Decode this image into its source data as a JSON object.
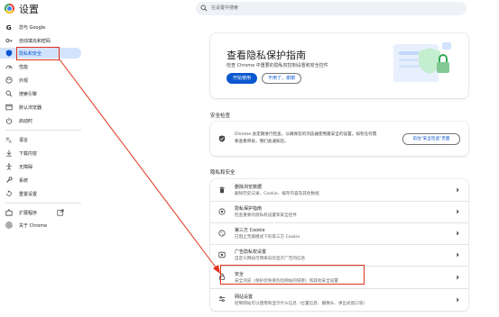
{
  "app": {
    "title": "设置"
  },
  "search": {
    "placeholder": "在设置中搜索"
  },
  "sidebar": {
    "items": [
      {
        "label": "您与 Google",
        "icon": "google-g-icon"
      },
      {
        "label": "自动填充和密码",
        "icon": "key-icon"
      },
      {
        "label": "隐私和安全",
        "icon": "shield-icon",
        "active": true
      },
      {
        "label": "性能",
        "icon": "speedometer-icon"
      },
      {
        "label": "外观",
        "icon": "palette-icon"
      },
      {
        "label": "搜索引擎",
        "icon": "search-icon"
      },
      {
        "label": "默认浏览器",
        "icon": "browser-window-icon"
      },
      {
        "label": "启动时",
        "icon": "power-icon"
      },
      {
        "label": "语言",
        "icon": "translate-icon"
      },
      {
        "label": "下载内容",
        "icon": "download-icon"
      },
      {
        "label": "无障碍",
        "icon": "accessibility-icon"
      },
      {
        "label": "系统",
        "icon": "wrench-icon"
      },
      {
        "label": "重置设置",
        "icon": "reset-icon"
      },
      {
        "label": "扩展程序",
        "icon": "puzzle-icon"
      },
      {
        "label": "关于 Chrome",
        "icon": "chrome-icon"
      }
    ]
  },
  "promo": {
    "title": "查看隐私保护指南",
    "description": "检查 Chrome 中重要的隐私权控制设置和安全控件",
    "primary_button": "开始使用",
    "secondary_button": "不用了，谢谢"
  },
  "safety_check": {
    "section_title": "安全检查",
    "text_line1": "Chrome 会定期进行检查，以确保您的浏览器使用最安全的设置。如有任何需",
    "text_line2": "要查看审核，我们会通知您。",
    "button": "前往\"安全检查\"页面"
  },
  "privacy": {
    "section_title": "隐私和安全",
    "rows": [
      {
        "title": "删除浏览数据",
        "subtitle": "删除历史记录、Cookie、缓存内容及其他数据",
        "icon": "trash-icon"
      },
      {
        "title": "隐私保护指南",
        "subtitle": "检查重要的隐私权设置和安全控件",
        "icon": "privacy-guide-icon"
      },
      {
        "title": "第三方 Cookie",
        "subtitle": "已阻止无痕模式下的第三方 Cookie",
        "icon": "cookie-icon"
      },
      {
        "title": "广告隐私权设置",
        "subtitle": "自定义网站可用来向您显示广告的信息",
        "icon": "ad-privacy-icon"
      },
      {
        "title": "安全",
        "subtitle": "安全浏览（保护您免受危险网站的侵害）和其他安全设置",
        "icon": "lock-icon",
        "highlighted": true
      },
      {
        "title": "网站设置",
        "subtitle": "控制网站可以使用和显示什么信息（位置信息、摄像头、弹出式窗口等）",
        "icon": "site-settings-icon"
      }
    ]
  },
  "colors": {
    "accent": "#0b57d0",
    "active_bg": "#d3e3fd",
    "annotation": "#e0301e"
  }
}
